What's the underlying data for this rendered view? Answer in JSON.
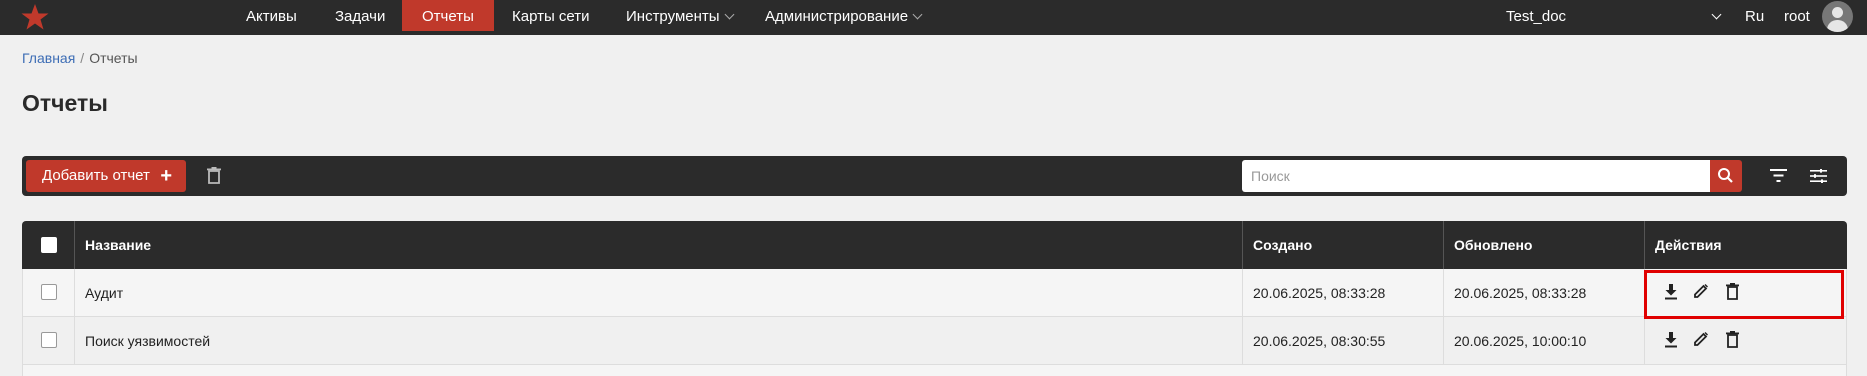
{
  "nav": {
    "items": [
      {
        "label": "Активы"
      },
      {
        "label": "Задачи"
      },
      {
        "label": "Отчеты"
      },
      {
        "label": "Карты сети"
      },
      {
        "label": "Инструменты"
      },
      {
        "label": "Администрирование"
      }
    ],
    "active": "Отчеты",
    "project": "Test_doc",
    "language": "Ru",
    "user": "root"
  },
  "breadcrumb": {
    "home": "Главная",
    "separator": "/",
    "current": "Отчеты"
  },
  "page": {
    "title": "Отчеты"
  },
  "toolbar": {
    "add_label": "Добавить отчет",
    "add_icon": "+",
    "search_placeholder": "Поиск"
  },
  "table": {
    "headers": {
      "name": "Название",
      "created": "Создано",
      "updated": "Обновлено",
      "actions": "Действия"
    },
    "rows": [
      {
        "name": "Аудит",
        "created": "20.06.2025, 08:33:28",
        "updated": "20.06.2025, 08:33:28"
      },
      {
        "name": "Поиск уязвимостей",
        "created": "20.06.2025, 08:30:55",
        "updated": "20.06.2025, 10:00:10"
      }
    ],
    "row_actions": [
      "download-icon",
      "edit-icon",
      "trash-icon"
    ]
  },
  "colors": {
    "accent": "#c0392b",
    "dark": "#2b2b2b",
    "highlight": "#e00000",
    "link": "#3d6db5"
  }
}
